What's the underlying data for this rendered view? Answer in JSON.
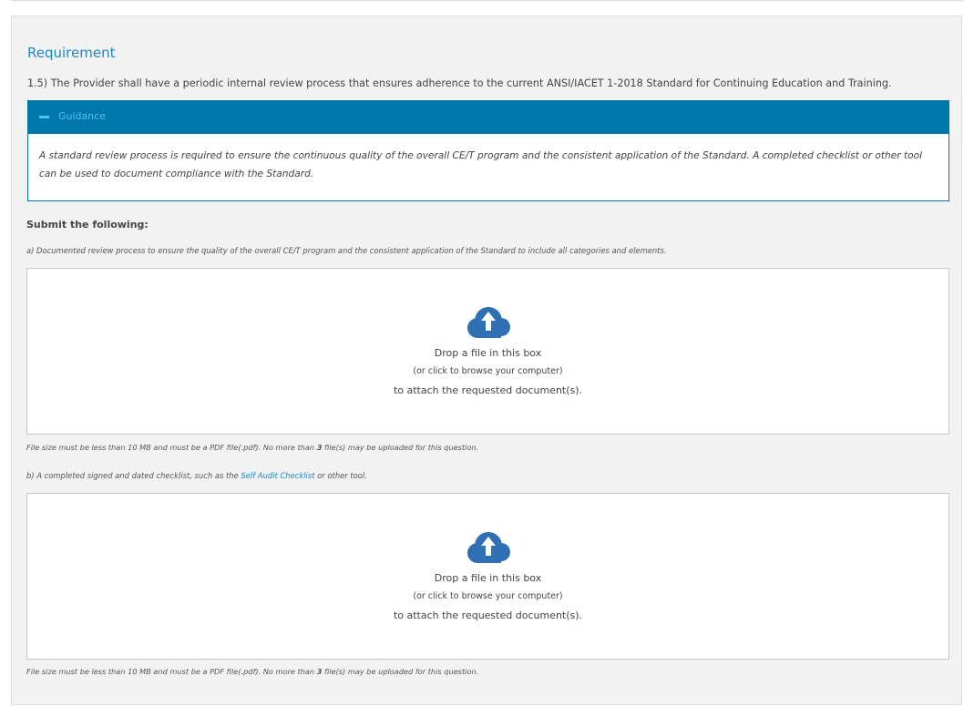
{
  "requirement": {
    "title": "Requirement",
    "text": "1.5) The Provider shall have a periodic internal review process that ensures adherence to the current ANSI/IACET 1-2018 Standard for Continuing Education and Training."
  },
  "guidance": {
    "label": "Guidance",
    "text": "A standard review process is required to ensure the continuous quality of the overall CE/T program and the consistent application of the Standard. A completed checklist or other tool can be used to document compliance with the Standard."
  },
  "submit": {
    "heading": "Submit the following:",
    "items": [
      {
        "desc": "a) Documented review process to ensure the quality of the overall CE/T program and the consistent application of the Standard to include all categories and elements.",
        "drop_line1": "Drop a file in this box",
        "drop_line2": "(or click to browse your computer)",
        "drop_line3": "to attach the requested document(s).",
        "size_prefix": "File size must be less than 10 MB and must be a PDF file(.pdf). No more than ",
        "max_files": "3",
        "size_suffix": " file(s) may be uploaded for this question."
      },
      {
        "desc_prefix": "b) A completed signed and dated checklist, such as the ",
        "desc_link": "Self Audit Checklist",
        "desc_suffix": " or other tool.",
        "drop_line1": "Drop a file in this box",
        "drop_line2": "(or click to browse your computer)",
        "drop_line3": "to attach the requested document(s).",
        "size_prefix": "File size must be less than 10 MB and must be a PDF file(.pdf). No more than ",
        "max_files": "3",
        "size_suffix": " file(s) may be uploaded for this question."
      }
    ]
  },
  "icons": {
    "upload": "cloud-upload-icon",
    "collapse": "minus-icon"
  },
  "colors": {
    "accent": "#1e87c7",
    "guidance_bar": "#0077a9",
    "guidance_text": "#4fc3f0",
    "upload_icon": "#2f6fb3"
  }
}
